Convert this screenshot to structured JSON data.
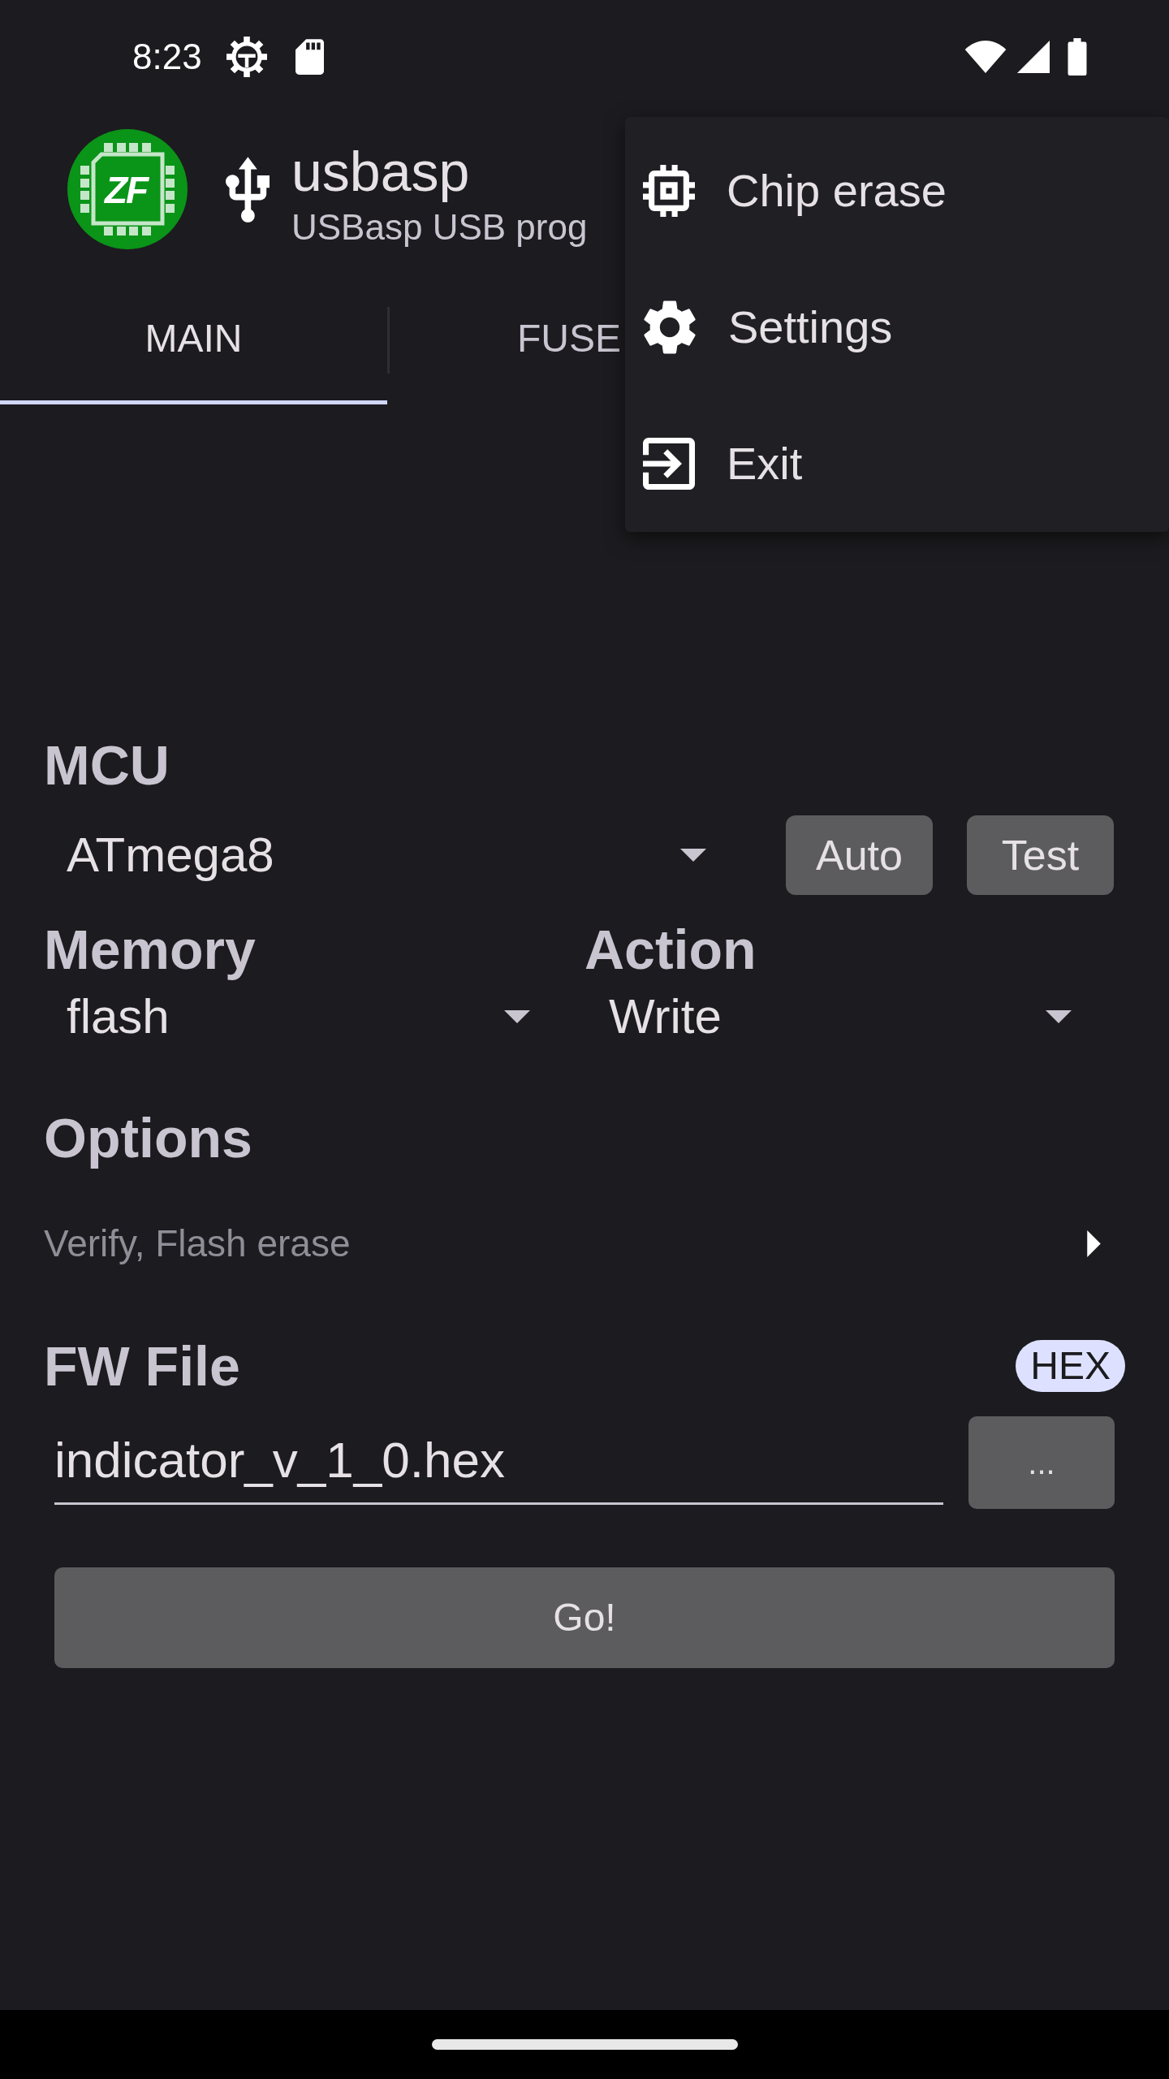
{
  "status_bar": {
    "time": "8:23"
  },
  "app_bar": {
    "logo_text": "ZF",
    "title": "usbasp",
    "subtitle": "USBasp USB prog"
  },
  "tabs": [
    {
      "label": "MAIN",
      "selected": true
    },
    {
      "label": "FUSE",
      "selected": false
    }
  ],
  "menu": {
    "items": [
      {
        "kind": "chip",
        "label": "Chip erase"
      },
      {
        "kind": "settings",
        "label": "Settings"
      },
      {
        "kind": "exit",
        "label": "Exit"
      }
    ]
  },
  "mcu": {
    "label": "MCU",
    "value": "ATmega8",
    "buttons": [
      "Auto",
      "Test"
    ]
  },
  "memory": {
    "label": "Memory",
    "value": "flash"
  },
  "action": {
    "label": "Action",
    "value": "Write"
  },
  "options": {
    "label": "Options",
    "summary": "Verify, Flash erase"
  },
  "fw_file": {
    "label": "FW File",
    "badge": "HEX",
    "value": "indicator_v_1_0.hex",
    "browse_button": "..."
  },
  "go_button": "Go!"
}
